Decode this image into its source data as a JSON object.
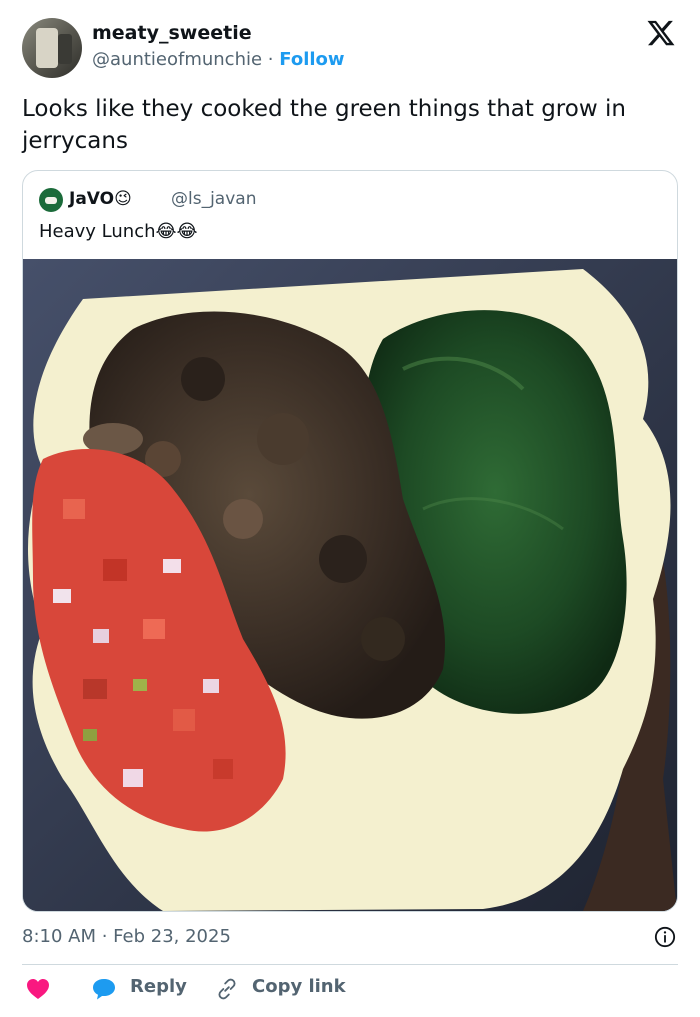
{
  "author": {
    "display_name": "meaty_sweetie",
    "handle": "@auntieofmunchie",
    "separator": "·",
    "follow_label": "Follow"
  },
  "tweet": {
    "text": "Looks like they cooked the green things that grow in jerrycans"
  },
  "quoted": {
    "display_name": "JaVO😉",
    "handle": "@ls_javan",
    "text": "Heavy Lunch😂😂"
  },
  "meta": {
    "timestamp": "8:10 AM · Feb 23, 2025"
  },
  "actions": {
    "reply_label": "Reply",
    "copy_label": "Copy link"
  },
  "colors": {
    "accent": "#1d9bf0",
    "like": "#f91880",
    "muted": "#536471"
  },
  "icons": {
    "brand": "x-logo-icon",
    "info": "info-icon",
    "like": "heart-icon",
    "reply": "speech-bubble-icon",
    "copy": "link-icon"
  }
}
